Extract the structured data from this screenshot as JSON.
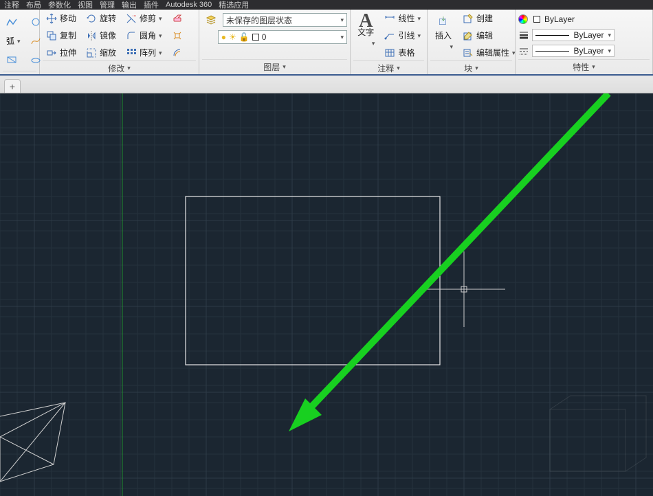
{
  "menubar": [
    "注释",
    "布局",
    "参数化",
    "视图",
    "管理",
    "输出",
    "插件",
    "Autodesk 360",
    "精选应用"
  ],
  "ribbon": {
    "modify": {
      "title": "修改",
      "buttons": {
        "move": "移动",
        "rotate": "旋转",
        "trim": "修剪",
        "copy": "复制",
        "mirror": "镜像",
        "fillet": "圆角",
        "stretch": "拉伸",
        "scale": "缩放",
        "array": "阵列"
      }
    },
    "layer": {
      "title": "图层",
      "state_label": "未保存的图层状态",
      "current_layer": "0"
    },
    "annotate": {
      "title": "注释",
      "text": "文字",
      "linear": "线性",
      "leader": "引线",
      "table": "表格"
    },
    "block": {
      "title": "块",
      "insert": "插入",
      "create": "创建",
      "edit": "编辑",
      "editattr": "编辑属性"
    },
    "properties": {
      "title": "特性",
      "bylayer": "ByLayer"
    }
  }
}
